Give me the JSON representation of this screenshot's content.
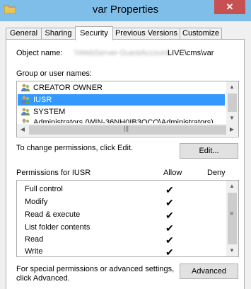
{
  "window": {
    "title": "var Properties",
    "close_glyph": "✕"
  },
  "tabs": [
    "General",
    "Sharing",
    "Security",
    "Previous Versions",
    "Customize"
  ],
  "object_name": {
    "label": "Object name:",
    "blurred": "\\\\WebServer-GuestAccount\\",
    "value": "LIVE\\cms\\var"
  },
  "groups": {
    "label": "Group or user names:",
    "items": [
      "CREATOR OWNER",
      "IUSR",
      "SYSTEM",
      "Administrators (WIN-36NH0IB3OCO\\Administrators)"
    ],
    "selected_index": 1
  },
  "change_hint": "To change permissions, click Edit.",
  "edit_button": "Edit...",
  "permissions": {
    "label": "Permissions for IUSR",
    "allow_header": "Allow",
    "deny_header": "Deny",
    "rows": [
      {
        "name": "Full control",
        "allow": true,
        "deny": false
      },
      {
        "name": "Modify",
        "allow": true,
        "deny": false
      },
      {
        "name": "Read & execute",
        "allow": true,
        "deny": false
      },
      {
        "name": "List folder contents",
        "allow": true,
        "deny": false
      },
      {
        "name": "Read",
        "allow": true,
        "deny": false
      },
      {
        "name": "Write",
        "allow": true,
        "deny": false
      }
    ],
    "check_glyph": "✔"
  },
  "advanced_hint_line1": "For special permissions or advanced settings,",
  "advanced_hint_line2": "click Advanced.",
  "advanced_button": "Advanced",
  "colors": {
    "titlebar": "#7fbee8",
    "selection": "#3399ff",
    "close": "#c75050"
  }
}
